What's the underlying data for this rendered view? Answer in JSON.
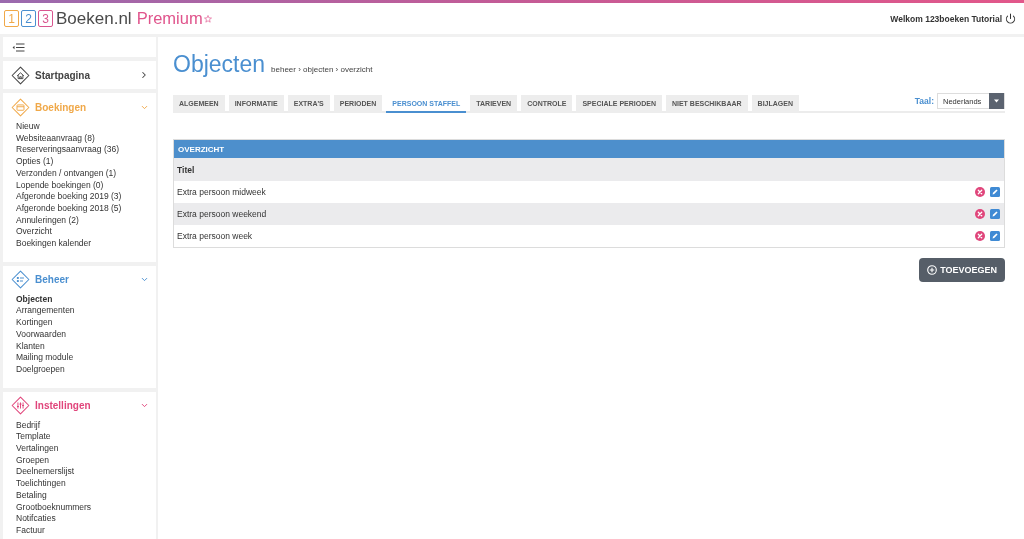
{
  "header": {
    "logo_digits": [
      {
        "text": "1",
        "color": "#f0a848"
      },
      {
        "text": "2",
        "color": "#4a8fd0"
      },
      {
        "text": "3",
        "color": "#d9568f"
      }
    ],
    "logo_name": "Boeken.nl",
    "edition": "Premium",
    "welcome": "Welkom 123boeken Tutorial"
  },
  "sidebar": {
    "sections": [
      {
        "label": "Startpagina",
        "color": "#444444",
        "expanded": false
      },
      {
        "label": "Boekingen",
        "color": "#f0a848",
        "expanded": true,
        "items": [
          {
            "label": "Nieuw",
            "selected": false
          },
          {
            "label": "Websiteaanvraag (8)",
            "selected": false
          },
          {
            "label": "Reserveringsaanvraag (36)",
            "selected": false
          },
          {
            "label": "Opties (1)",
            "selected": false
          },
          {
            "label": "Verzonden / ontvangen (1)",
            "selected": false
          },
          {
            "label": "Lopende boekingen (0)",
            "selected": false
          },
          {
            "label": "Afgeronde boeking 2019 (3)",
            "selected": false
          },
          {
            "label": "Afgeronde boeking 2018 (5)",
            "selected": false
          },
          {
            "label": "Annuleringen (2)",
            "selected": false
          },
          {
            "label": "Overzicht",
            "selected": false
          },
          {
            "label": "Boekingen kalender",
            "selected": false
          }
        ]
      },
      {
        "label": "Beheer",
        "color": "#4a8fd0",
        "expanded": true,
        "items": [
          {
            "label": "Objecten",
            "selected": true
          },
          {
            "label": "Arrangementen",
            "selected": false
          },
          {
            "label": "Kortingen",
            "selected": false
          },
          {
            "label": "Voorwaarden",
            "selected": false
          },
          {
            "label": "Klanten",
            "selected": false
          },
          {
            "label": "Mailing module",
            "selected": false
          },
          {
            "label": "Doelgroepen",
            "selected": false
          }
        ]
      },
      {
        "label": "Instellingen",
        "color": "#e0457b",
        "expanded": true,
        "items": [
          {
            "label": "Bedrijf",
            "selected": false
          },
          {
            "label": "Template",
            "selected": false
          },
          {
            "label": "Vertalingen",
            "selected": false
          },
          {
            "label": "Groepen",
            "selected": false
          },
          {
            "label": "Deelnemerslijst",
            "selected": false
          },
          {
            "label": "Toelichtingen",
            "selected": false
          },
          {
            "label": "Betaling",
            "selected": false
          },
          {
            "label": "Grootboeknummers",
            "selected": false
          },
          {
            "label": "Notifcaties",
            "selected": false
          },
          {
            "label": "Factuur",
            "selected": false
          }
        ]
      }
    ]
  },
  "page": {
    "title": "Objecten",
    "breadcrumb": "beheer › objecten › overzicht"
  },
  "tabs": [
    {
      "label": "ALGEMEEN",
      "selected": false
    },
    {
      "label": "INFORMATIE",
      "selected": false
    },
    {
      "label": "EXTRA'S",
      "selected": false
    },
    {
      "label": "PERIODEN",
      "selected": false
    },
    {
      "label": "PERSOON STAFFEL",
      "selected": true
    },
    {
      "label": "TARIEVEN",
      "selected": false
    },
    {
      "label": "CONTROLE",
      "selected": false
    },
    {
      "label": "SPECIALE PERIODEN",
      "selected": false
    },
    {
      "label": "NIET BESCHIKBAAR",
      "selected": false
    },
    {
      "label": "BIJLAGEN",
      "selected": false
    }
  ],
  "language": {
    "label": "Taal:",
    "value": "Nederlands"
  },
  "panel": {
    "title": "OVERZICHT",
    "columns": [
      "Titel"
    ],
    "rows": [
      {
        "cells": [
          "Extra persoon midweek"
        ]
      },
      {
        "cells": [
          "Extra persoon weekend"
        ]
      },
      {
        "cells": [
          "Extra persoon week"
        ]
      }
    ]
  },
  "add_button": {
    "label": "TOEVOEGEN"
  }
}
